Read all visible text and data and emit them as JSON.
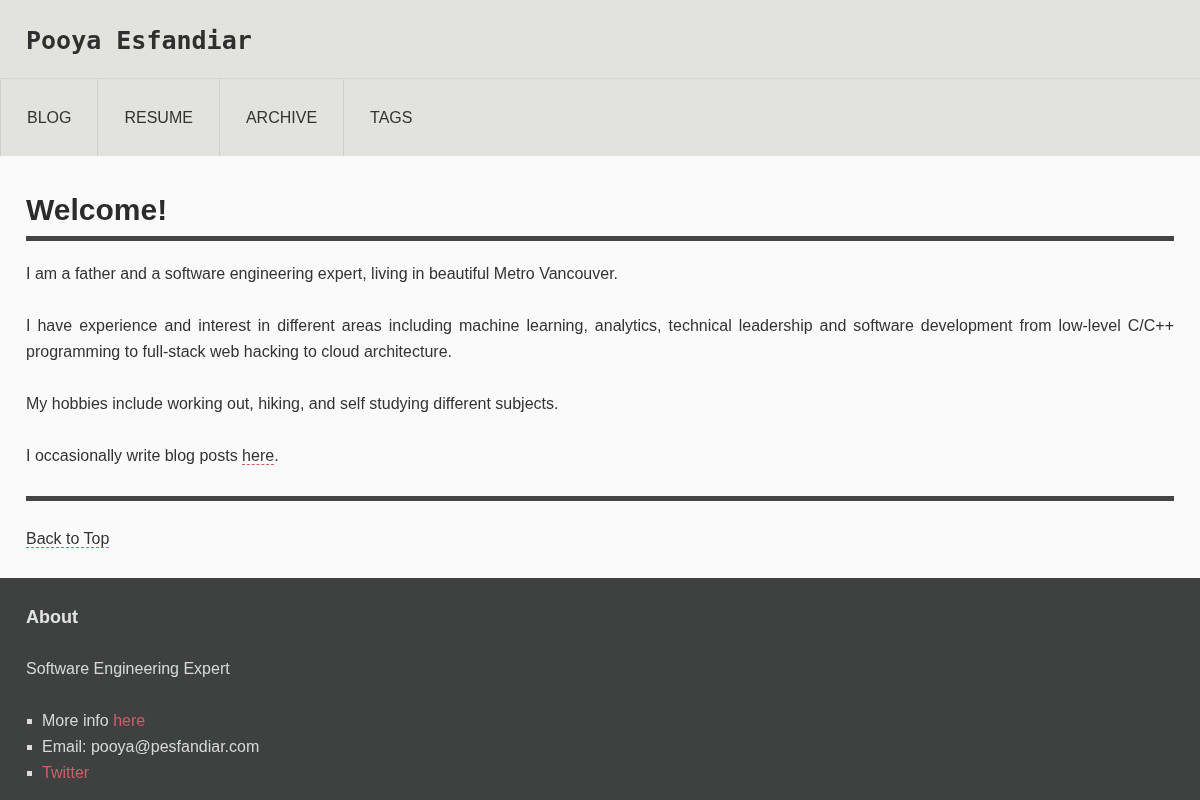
{
  "header": {
    "title": "Pooya Esfandiar",
    "nav": [
      {
        "label": "BLOG"
      },
      {
        "label": "RESUME"
      },
      {
        "label": "ARCHIVE"
      },
      {
        "label": "TAGS"
      }
    ]
  },
  "content": {
    "heading": "Welcome!",
    "paragraphs": [
      {
        "text": "I am a father and a software engineering expert, living in beautiful Metro Vancouver."
      },
      {
        "text": "I have experience and interest in different areas including machine learning, analytics, technical leadership and software development from low-level C/C++ programming to full-stack web hacking to cloud architecture."
      },
      {
        "text": "My hobbies include working out, hiking, and self studying different subjects."
      },
      {
        "text": "I occasionally write blog posts ",
        "link": "here",
        "after": "."
      }
    ],
    "back_to_top": "Back to Top"
  },
  "footer": {
    "heading": "About",
    "tagline": "Software Engineering Expert",
    "items": [
      {
        "text": "More info ",
        "link": "here"
      },
      {
        "text": "Email: pooya@pesfandiar.com"
      },
      {
        "link": "Twitter"
      }
    ]
  }
}
